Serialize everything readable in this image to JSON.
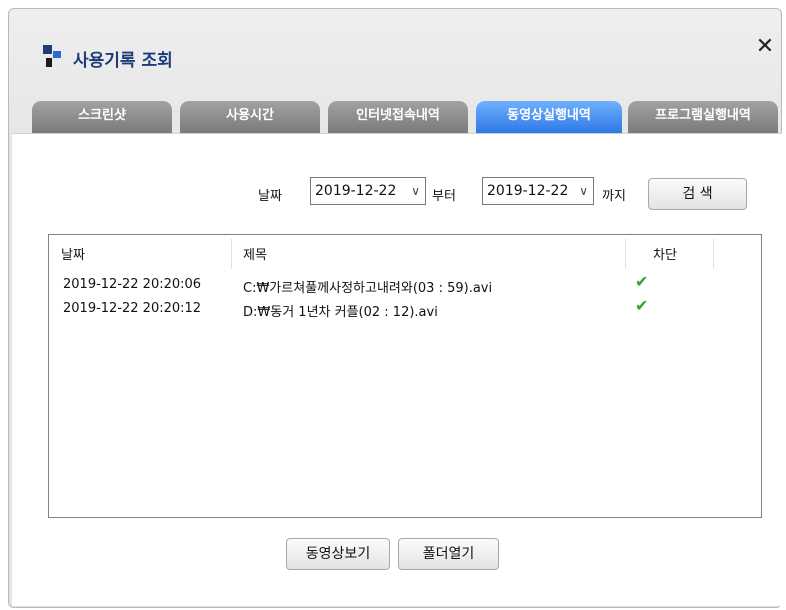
{
  "window": {
    "title": "사용기록 조회",
    "close_label": "✕"
  },
  "tabs": [
    {
      "label": "스크린샷",
      "active": false
    },
    {
      "label": "사용시간",
      "active": false
    },
    {
      "label": "인터넷접속내역",
      "active": false
    },
    {
      "label": "동영상실행내역",
      "active": true
    },
    {
      "label": "프로그램실행내역",
      "active": false
    }
  ],
  "filter": {
    "date_label": "날짜",
    "from_date": "2019-12-22",
    "from_suffix": "부터",
    "to_date": "2019-12-22",
    "to_suffix": "까지",
    "search_button": "검 색"
  },
  "table": {
    "columns": [
      "날짜",
      "제목",
      "차단"
    ],
    "rows": [
      {
        "date": "2019-12-22 20:20:06",
        "title": "C:₩가르쳐풀께사정하고내려와(03 : 59).avi",
        "blocked": "✔"
      },
      {
        "date": "2019-12-22 20:20:12",
        "title": "D:₩동거 1년차 커플(02 : 12).avi",
        "blocked": "✔"
      }
    ]
  },
  "buttons": {
    "view_video": "동영상보기",
    "open_folder": "폴더열기"
  },
  "colors": {
    "active_tab": "#2d78e6",
    "inactive_tab": "#8a8a8a",
    "title_text": "#1e3c7a",
    "check": "#2fa52f"
  }
}
